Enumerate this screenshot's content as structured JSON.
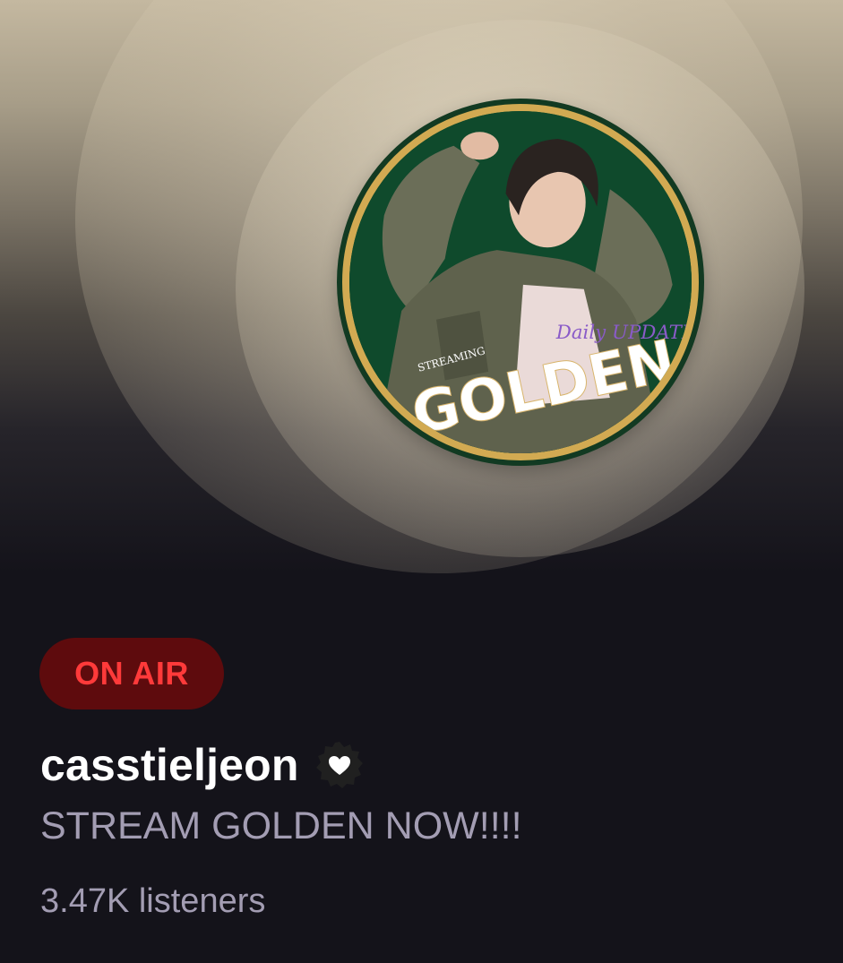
{
  "artwork": {
    "overlay_small": "STREAMING",
    "overlay_large": "GOLDEN",
    "watermark": "Daily UPDATE"
  },
  "status_badge": "ON AIR",
  "host": {
    "username": "casstieljeon",
    "badge_icon": "heart-seal-icon"
  },
  "room_title": "STREAM GOLDEN NOW!!!!",
  "listener_count": "3.47K listeners",
  "colors": {
    "background": "#14131a",
    "on_air_bg": "#5e0b0d",
    "on_air_text": "#ff3a3a",
    "secondary_text": "#a39db3",
    "ring_gold": "#d2aa52",
    "artwork_green": "#0f4a2c"
  }
}
